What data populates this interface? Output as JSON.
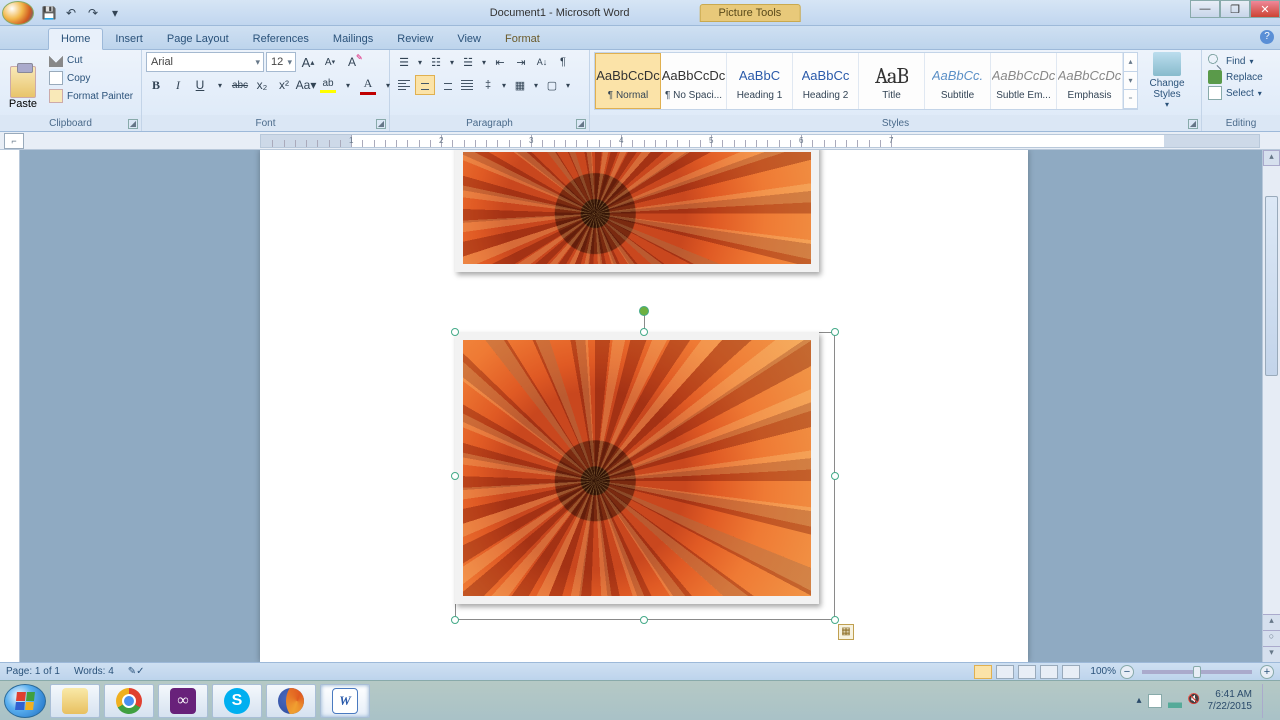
{
  "title": {
    "document": "Document1 - Microsoft Word",
    "contextual_tab": "Picture Tools"
  },
  "qat": {
    "save": "💾",
    "undo": "↶",
    "redo": "↷",
    "customize": "▾"
  },
  "window_controls": {
    "min": "—",
    "max": "❐",
    "close": "✕"
  },
  "tabs": [
    "Home",
    "Insert",
    "Page Layout",
    "References",
    "Mailings",
    "Review",
    "View",
    "Format"
  ],
  "active_tab": "Home",
  "help": "?",
  "ribbon": {
    "clipboard": {
      "label": "Clipboard",
      "paste": "Paste",
      "cut": "Cut",
      "copy": "Copy",
      "format_painter": "Format Painter"
    },
    "font": {
      "label": "Font",
      "name": "Arial",
      "size": "12",
      "grow": "A",
      "shrink": "A",
      "clear": "Aa",
      "bold": "B",
      "italic": "I",
      "underline": "U",
      "strike": "abc",
      "sub": "x₂",
      "sup": "x²",
      "case": "Aa▾",
      "highlight_color": "#ffff00",
      "font_color": "#c00000"
    },
    "paragraph": {
      "label": "Paragraph"
    },
    "styles": {
      "label": "Styles",
      "items": [
        {
          "preview": "AaBbCcDc",
          "name": "¶ Normal",
          "cls": "",
          "sel": true
        },
        {
          "preview": "AaBbCcDc",
          "name": "¶ No Spaci...",
          "cls": ""
        },
        {
          "preview": "AaBbC",
          "name": "Heading 1",
          "cls": "blue"
        },
        {
          "preview": "AaBbCc",
          "name": "Heading 2",
          "cls": "blue"
        },
        {
          "preview": "AaB",
          "name": "Title",
          "cls": "big"
        },
        {
          "preview": "AaBbCc.",
          "name": "Subtitle",
          "cls": "lightblue"
        },
        {
          "preview": "AaBbCcDc",
          "name": "Subtle Em...",
          "cls": "italicg"
        },
        {
          "preview": "AaBbCcDc",
          "name": "Emphasis",
          "cls": "italicg"
        }
      ],
      "change_styles": "Change Styles"
    },
    "editing": {
      "label": "Editing",
      "find": "Find",
      "replace": "Replace",
      "select": "Select"
    }
  },
  "ruler": {
    "numbers": [
      "1",
      "2",
      "3",
      "4",
      "5",
      "6",
      "7"
    ]
  },
  "status": {
    "page": "Page: 1 of 1",
    "words": "Words: 4",
    "zoom_pct": "100%",
    "minus": "−",
    "plus": "+"
  },
  "taskbar": {
    "tray_up": "▴",
    "time": "6:41 AM",
    "date": "7/22/2015"
  }
}
